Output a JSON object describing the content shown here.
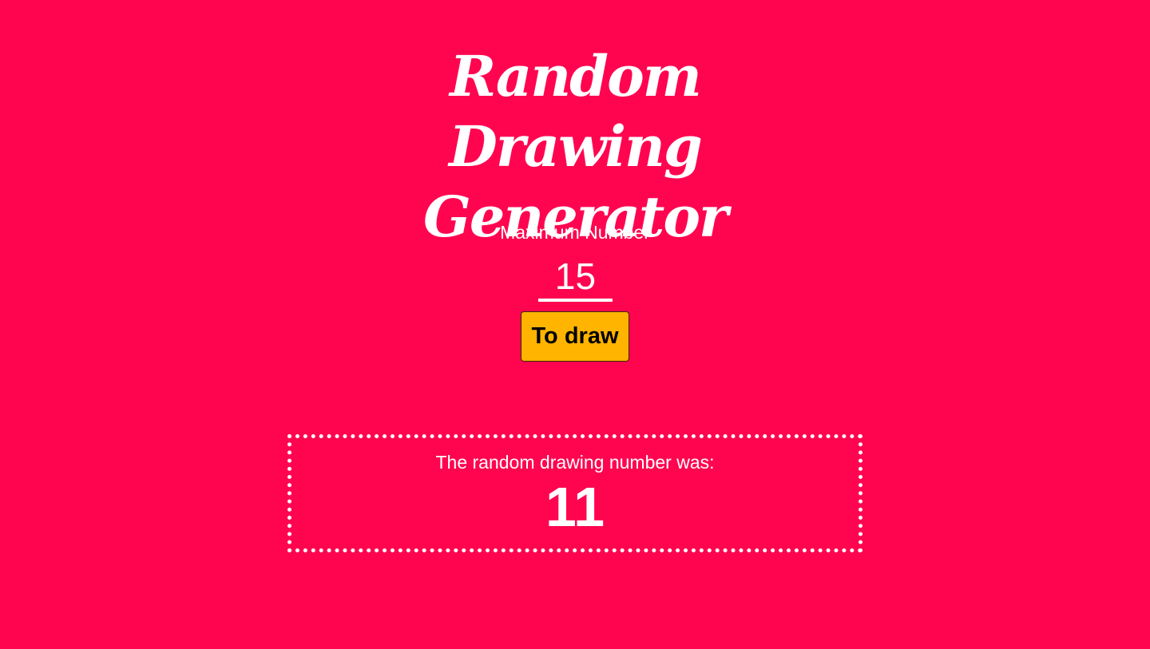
{
  "header": {
    "title": "Random Drawing Generator"
  },
  "form": {
    "max_label": "Maximum Number",
    "max_value": "15",
    "draw_button_label": "To draw"
  },
  "result": {
    "label": "The random drawing number was:",
    "number": "11"
  },
  "colors": {
    "background": "#ff0550",
    "button": "#ffb400",
    "text": "#ffffff"
  }
}
